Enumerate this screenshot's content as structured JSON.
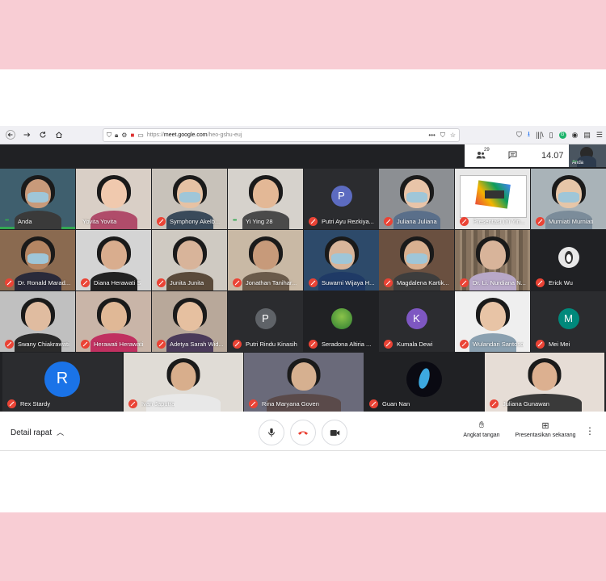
{
  "browser": {
    "url_prefix": "https://",
    "url_host": "meet.google.com",
    "url_path": "/heo-gshu-euj",
    "url_more": "•••",
    "badge_count": "29"
  },
  "meet": {
    "participant_count": "29",
    "time": "14.07",
    "self_label": "Anda",
    "tiles": [
      {
        "name": "Anda",
        "state": "talking"
      },
      {
        "name": "Yovita Yovita",
        "state": "none"
      },
      {
        "name": "Symphony Akelb...",
        "state": "muted"
      },
      {
        "name": "Yi Ying 28",
        "state": "talking"
      },
      {
        "name": "Putri Ayu Rezkiya...",
        "state": "muted",
        "avatar": "P",
        "avatar_color": "#5c6bc0"
      },
      {
        "name": "Juliana Juliana",
        "state": "muted"
      },
      {
        "name": "Presentasi (Yi Yin...",
        "state": "muted"
      },
      {
        "name": "Murniati Murniati",
        "state": "muted"
      },
      {
        "name": "Dr. Ronald Marad...",
        "state": "muted"
      },
      {
        "name": "Diana Herawati S",
        "state": "muted"
      },
      {
        "name": "Junita Junita",
        "state": "muted"
      },
      {
        "name": "Jonathan Tanihar...",
        "state": "muted"
      },
      {
        "name": "Suwarni Wijaya H...",
        "state": "muted"
      },
      {
        "name": "Magdalena Kartik...",
        "state": "muted"
      },
      {
        "name": "Dr. Li. Nurdiana N...",
        "state": "muted"
      },
      {
        "name": "Erick Wu",
        "state": "muted"
      },
      {
        "name": "Swany Chiakrawati",
        "state": "muted"
      },
      {
        "name": "Herawati Herawati",
        "state": "muted"
      },
      {
        "name": "Adetya Sarah Wid...",
        "state": "muted"
      },
      {
        "name": "Putri Rindu Kinasih",
        "state": "muted",
        "avatar": "P",
        "avatar_color": "#5f6368"
      },
      {
        "name": "Seradona Altiria ...",
        "state": "muted"
      },
      {
        "name": "Kumala Dewi",
        "state": "muted",
        "avatar": "K",
        "avatar_color": "#7e57c2"
      },
      {
        "name": "Wulandari Santoso",
        "state": "muted"
      },
      {
        "name": "Mei Mei",
        "state": "muted",
        "avatar": "M",
        "avatar_color": "#00897b"
      },
      {
        "name": "Rex Stardy",
        "state": "muted",
        "avatar": "R",
        "avatar_color": "#1a73e8"
      },
      {
        "name": "Ivan Japutra",
        "state": "muted"
      },
      {
        "name": "Rina Maryana Goven",
        "state": "muted"
      },
      {
        "name": "Guan Nan",
        "state": "muted"
      },
      {
        "name": "Juliana Gunawan",
        "state": "muted"
      }
    ]
  },
  "bottom": {
    "details_label": "Detail rapat",
    "raise_hand_label": "Angkat tangan",
    "present_label": "Presentasikan sekarang"
  },
  "icons": {
    "back": "back-arrow-icon",
    "forward": "forward-arrow-icon",
    "reload": "reload-icon",
    "home": "home-icon",
    "mic": "mic-icon",
    "end_call": "phone-hangup-icon",
    "camera": "camera-icon",
    "hand": "raise-hand-icon",
    "present": "present-screen-icon",
    "more": "more-vertical-icon"
  },
  "colors": {
    "meet_background": "#202124",
    "muted_red": "#ea4335",
    "talk_green": "#34a853",
    "page_pink": "#f8cdd4"
  }
}
